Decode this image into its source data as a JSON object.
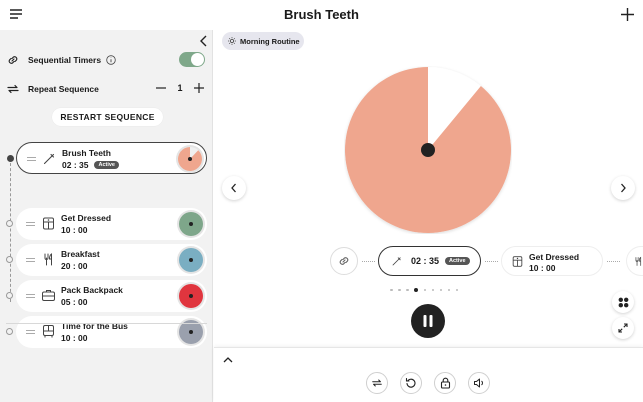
{
  "header": {
    "title": "Brush Teeth"
  },
  "sidebar": {
    "sequential_label": "Sequential Timers",
    "sequential_on": true,
    "repeat_label": "Repeat Sequence",
    "repeat_count": "1",
    "restart_label": "RESTART SEQUENCE",
    "timers": [
      {
        "name": "Brush Teeth",
        "time": "02 : 35",
        "badge": "Active",
        "icon": "toothbrush-icon",
        "color": "#efa68e",
        "active": true,
        "progress": 0.88
      },
      {
        "name": "Get Dressed",
        "time": "10 : 00",
        "icon": "closet-icon",
        "color": "#7ea68a"
      },
      {
        "name": "Breakfast",
        "time": "20 : 00",
        "icon": "fork-knife-icon",
        "color": "#7aaec2"
      },
      {
        "name": "Pack Backpack",
        "time": "05 : 00",
        "icon": "backpack-icon",
        "color": "#e0353e"
      },
      {
        "name": "Time for the Bus",
        "time": "10 : 00",
        "icon": "bus-icon",
        "color": "#9aa0ad"
      }
    ]
  },
  "main": {
    "routine_chip": "Morning Routine",
    "dial": {
      "color": "#efa68e",
      "remaining_fraction": 0.89
    },
    "active_card": {
      "time": "02 : 35",
      "badge": "Active"
    },
    "next_card": {
      "name": "Get Dressed",
      "time": "10 : 00"
    },
    "pager": {
      "count": 9,
      "current": 4
    }
  }
}
